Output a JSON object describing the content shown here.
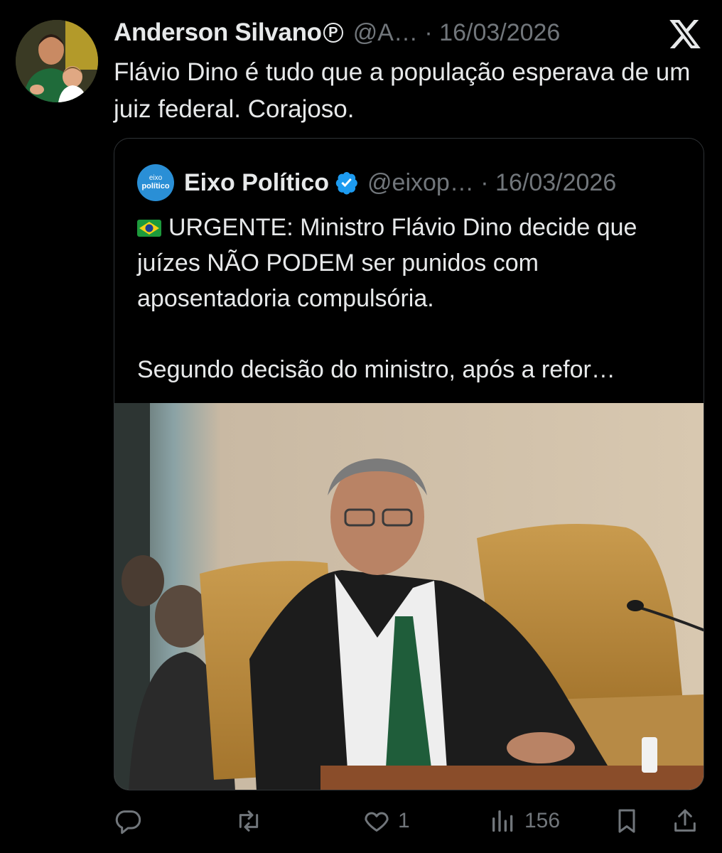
{
  "tweet": {
    "author_name": "Anderson Silvano",
    "author_badge": "P",
    "meta": "@A… · 16/03/2026",
    "text": "Flávio Dino é tudo que a população esperava de um juiz federal. Corajoso."
  },
  "quote": {
    "avatar_line1": "eixo",
    "avatar_line2": "político",
    "name": "Eixo Político",
    "meta": "@eixop… · 16/03/2026",
    "paragraph1": "URGENTE: Ministro Flávio Dino decide que juízes NÃO PODEM ser punidos com aposentadoria compulsória.",
    "paragraph2": "Segundo decisão do ministro, após a refor…",
    "flag_icon": "brazil-flag-icon"
  },
  "actions": {
    "reply_count": "",
    "retweet_count": "",
    "like_count": "1",
    "views_count": "156"
  },
  "colors": {
    "background": "#000000",
    "text": "#e7e9ea",
    "muted": "#71767b",
    "border": "#2f3336",
    "verified": "#1d9bf0"
  }
}
